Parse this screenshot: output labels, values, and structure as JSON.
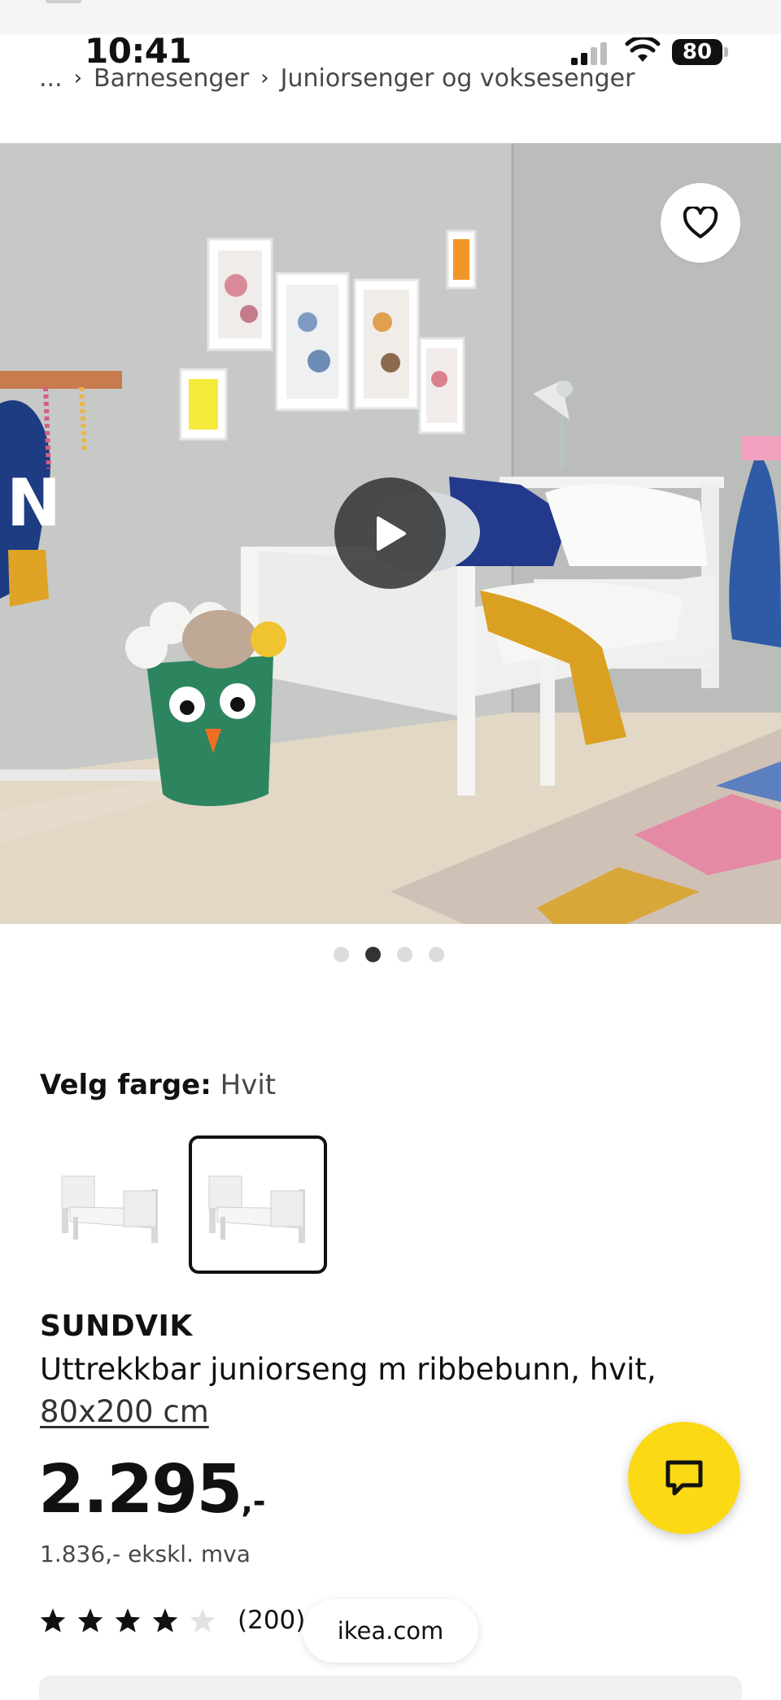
{
  "status_bar": {
    "time": "10:41",
    "battery": "80"
  },
  "breadcrumb": {
    "ellipsis": "...",
    "items": [
      "Barnesenger",
      "Juniorsenger og voksesenger"
    ],
    "separator": "›"
  },
  "hero": {
    "favorite_icon": "heart-icon",
    "play_icon": "play-icon",
    "carousel_pages": 4,
    "active_page": 2
  },
  "color_selection": {
    "label": "Velg farge:",
    "value": "Hvit",
    "swatches": 2,
    "selected_swatch": 2
  },
  "product": {
    "name": "SUNDVIK",
    "description": "Uttrekkbar juniorseng m ribbebunn, hvit,",
    "size": "80x200 cm",
    "price": "2.295",
    "price_suffix": ",-",
    "price_ex_vat": "1.836,- ekskl. mva",
    "rating": 4,
    "rating_max": 5,
    "review_count": "(200)"
  },
  "browser": {
    "url": "ikea.com"
  },
  "chat": {
    "icon": "chat-bubble-icon"
  },
  "colors": {
    "accent_yellow": "#fbd914",
    "text": "#111111",
    "secondary_text": "#484848"
  }
}
